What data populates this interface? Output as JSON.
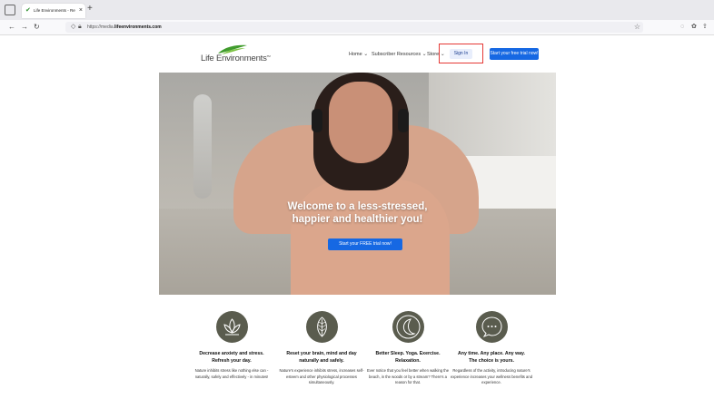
{
  "browser": {
    "tab_title": "Life Environments - Refresh Yo...",
    "url_prefix": "https://media.",
    "url_domain": "lifeenvironments.com",
    "icons": [
      "sidebar-icon",
      "back-icon",
      "forward-icon",
      "reload-icon",
      "shield-icon",
      "lock-icon",
      "bookmark-star-icon",
      "pocket-icon",
      "extensions-icon",
      "share-icon"
    ]
  },
  "header": {
    "logo_text": "Life Environments",
    "logo_tm": "TM",
    "menu": [
      {
        "label": "Home",
        "has_dropdown": true
      },
      {
        "label": "Subscriber Resources",
        "has_dropdown": true
      },
      {
        "label": "Store",
        "has_dropdown": true
      }
    ],
    "sign_in": "Sign In",
    "trial_button": "Start your free trial now!",
    "highlight_color": "#e53935",
    "accent_color": "#1668e3"
  },
  "hero": {
    "title_line1": "Welcome to a less-stressed,",
    "title_line2": "happier and healthier you!",
    "cta": "Start your FREE trial now!"
  },
  "features": [
    {
      "icon": "lotus-icon",
      "title_line1": "Decrease anxiety and stress.",
      "title_line2": "Refresh your day.",
      "desc": "Nature inhibits stress like nothing else can - naturally, safely and effectively - in minutes!"
    },
    {
      "icon": "leaf-icon",
      "title_line1": "Reset your brain, mind and day",
      "title_line2": "naturally and safely.",
      "desc": "Nature's experience inhibits stress, increases self-esteem and other physiological processes simultaneously."
    },
    {
      "icon": "moon-icon",
      "title_line1": "Better Sleep. Yoga. Exercise.",
      "title_line2": "Relaxation.",
      "desc": "Ever notice that you feel better when walking the beach, in the woods or by a stream? There's a reason for that."
    },
    {
      "icon": "chat-bubble-icon",
      "title_line1": "Any time. Any place. Any way.",
      "title_line2": "The choice is yours.",
      "desc": "Regardless of the activity, introducing nature's experience increases your wellness benefits and experience."
    }
  ]
}
